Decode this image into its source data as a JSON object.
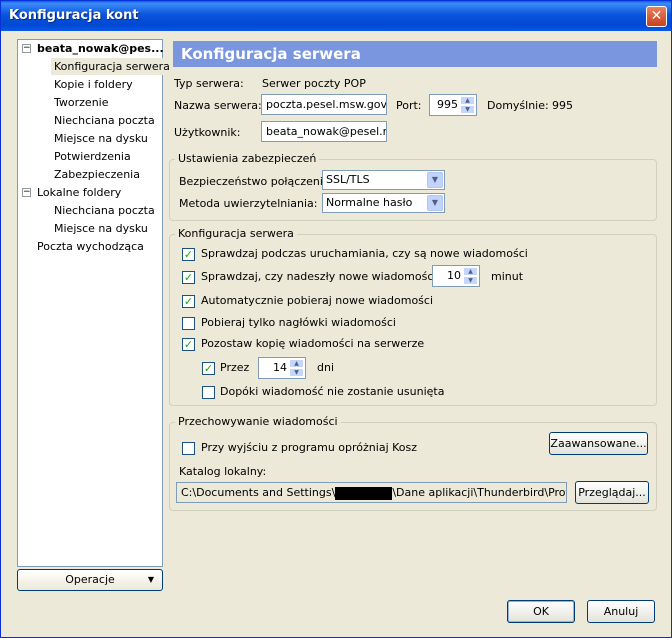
{
  "window": {
    "title": "Konfiguracja kont"
  },
  "tree": {
    "account": "beata_nowak@pes...",
    "account_items": [
      "Konfiguracja serwera",
      "Kopie i foldery",
      "Tworzenie",
      "Niechciana poczta",
      "Miejsce na dysku",
      "Potwierdzenia",
      "Zabezpieczenia"
    ],
    "local": "Lokalne foldery",
    "local_items": [
      "Niechciana poczta",
      "Miejsce na dysku"
    ],
    "outgoing": "Poczta wychodząca"
  },
  "operations_button": "Operacje",
  "panel": {
    "title": "Konfiguracja serwera",
    "server_type_label": "Typ serwera:",
    "server_type_value": "Serwer poczty POP",
    "server_name_label": "Nazwa serwera:",
    "server_name_value": "poczta.pesel.msw.gov.pl",
    "port_label": "Port:",
    "port_value": "995",
    "default_label": "Domyślnie:",
    "default_value": "995",
    "user_label": "Użytkownik:",
    "user_value": "beata_nowak@pesel.msw.gov.pl"
  },
  "security": {
    "legend": "Ustawienia zabezpieczeń",
    "connection_label": "Bezpieczeństwo połączenia:",
    "connection_value": "SSL/TLS",
    "auth_label": "Metoda uwierzytelniania:",
    "auth_value": "Normalne hasło"
  },
  "server_settings": {
    "legend": "Konfiguracja serwera",
    "check_startup": "Sprawdzaj podczas uruchamiania, czy są nowe wiadomości",
    "check_every": "Sprawdzaj, czy nadeszły nowe wiadomości co",
    "check_every_value": "10",
    "check_every_unit": "minut",
    "auto_download": "Automatycznie pobieraj nowe wiadomości",
    "headers_only": "Pobieraj tylko nagłówki wiadomości",
    "leave_copies": "Pozostaw kopię wiadomości na serwerze",
    "for_label": "Przez",
    "for_value": "14",
    "for_unit": "dni",
    "until_deleted": "Dopóki wiadomość nie zostanie usunięta",
    "checked": {
      "startup": true,
      "every": true,
      "auto": true,
      "headers": false,
      "leave": true,
      "for": true,
      "until": false
    }
  },
  "storage": {
    "legend": "Przechowywanie wiadomości",
    "empty_trash": "Przy wyjściu z programu opróżniaj Kosz",
    "advanced_button": "Zaawansowane...",
    "local_dir_label": "Katalog lokalny:",
    "local_dir_prefix": "C:\\Documents and Settings\\",
    "local_dir_suffix": "\\Dane aplikacji\\Thunderbird\\Profiles\\jcgc",
    "browse_button": "Przeglądaj..."
  },
  "dialog": {
    "ok": "OK",
    "cancel": "Anuluj"
  }
}
